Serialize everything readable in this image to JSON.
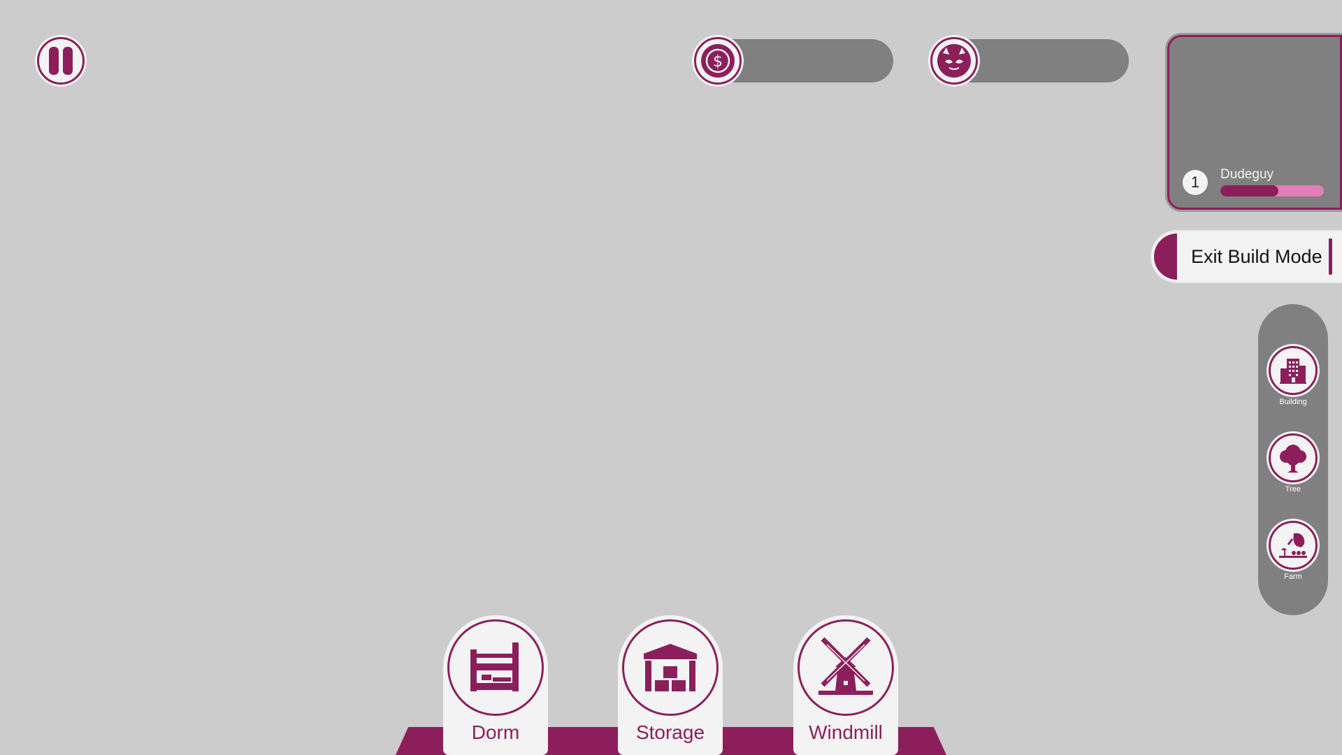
{
  "theme": {
    "accent": "#8c1f5b",
    "accent_light": "#e07fb8",
    "panel_gray": "#808080",
    "background": "#cccccc",
    "card_white": "#f3f3f3"
  },
  "hud": {
    "pause": {
      "icon": "pause-icon"
    },
    "money": {
      "icon": "dollar-coin-icon",
      "value": ""
    },
    "population": {
      "icon": "creature-face-icon",
      "value": ""
    }
  },
  "player": {
    "level": "1",
    "name": "Dudeguy",
    "xp_progress": 0.56
  },
  "build_mode": {
    "exit_label": "Exit Build Mode"
  },
  "categories": [
    {
      "label": "Building",
      "icon": "building-icon"
    },
    {
      "label": "Tree",
      "icon": "tree-icon"
    },
    {
      "label": "Farm",
      "icon": "farm-icon"
    }
  ],
  "build_items": [
    {
      "label": "Dorm",
      "icon": "bunk-bed-icon"
    },
    {
      "label": "Storage",
      "icon": "warehouse-icon"
    },
    {
      "label": "Windmill",
      "icon": "windmill-icon"
    }
  ]
}
